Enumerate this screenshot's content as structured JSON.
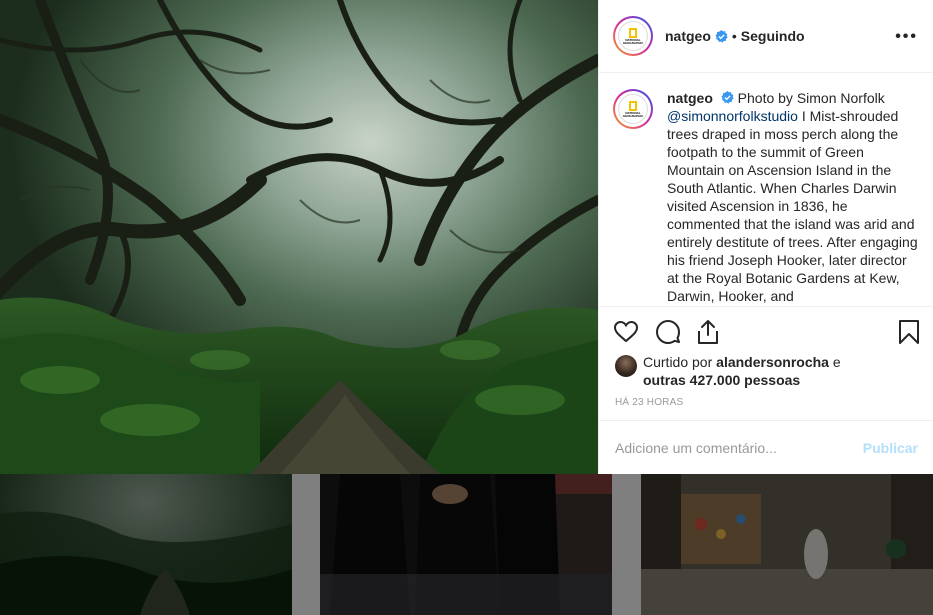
{
  "post": {
    "username": "natgeo",
    "dot": "•",
    "follow_status": "Seguindo",
    "more": "•••",
    "avatar_logo_text": "NATIONAL GEOGRAPHIC",
    "caption": {
      "username": "natgeo",
      "prefix": "Photo by Simon Norfolk",
      "mention": "@simonnorfolkstudio",
      "body": "I Mist-shrouded trees draped in moss perch along the footpath to the summit of Green Mountain on Ascension Island in the South Atlantic. When Charles Darwin visited Ascension in 1836, he commented that the island was arid and entirely destitute of trees. After engaging his friend Joseph Hooker, later director at the Royal Botanic Gardens at Kew, Darwin, Hooker, and"
    },
    "likes": {
      "prefix": "Curtido por",
      "user": "alandersonrocha",
      "connector": "e",
      "others": "outras 427.000 pessoas"
    },
    "time": "HÁ 23 HORAS",
    "comment": {
      "placeholder": "Adicione um comentário...",
      "publish": "Publicar"
    }
  },
  "icons": {
    "like": "heart-icon",
    "comment": "comment-icon",
    "share": "share-icon",
    "save": "bookmark-icon",
    "verified": "verified-badge-icon"
  },
  "colors": {
    "verified": "#3897f0",
    "publish_disabled": "#b2dffc",
    "mention": "#003569"
  }
}
